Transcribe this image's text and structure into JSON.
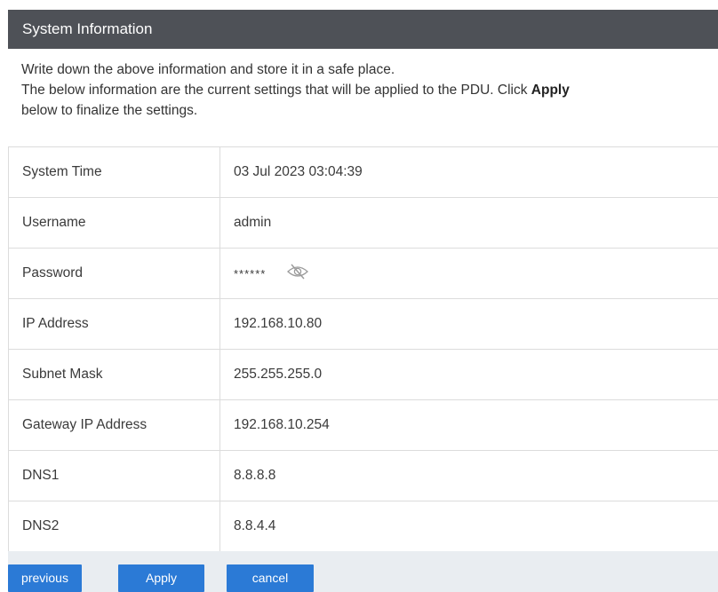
{
  "header": {
    "title": "System Information"
  },
  "intro": {
    "line1": "Write down the above information and store it in a safe place.",
    "line2_prefix": "The below information are the current settings that will be applied to the PDU. Click ",
    "line2_bold": "Apply",
    "line3": "below to finalize the settings."
  },
  "rows": [
    {
      "label": "System Time",
      "value": "03 Jul 2023 03:04:39"
    },
    {
      "label": "Username",
      "value": "admin"
    },
    {
      "label": "Password",
      "value": "******",
      "icon": "eye-slash-icon"
    },
    {
      "label": "IP Address",
      "value": "192.168.10.80"
    },
    {
      "label": "Subnet Mask",
      "value": "255.255.255.0"
    },
    {
      "label": "Gateway IP Address",
      "value": "192.168.10.254"
    },
    {
      "label": "DNS1",
      "value": "8.8.8.8"
    },
    {
      "label": "DNS2",
      "value": "8.8.4.4"
    }
  ],
  "buttons": {
    "previous": "previous",
    "apply": "Apply",
    "cancel": "cancel"
  },
  "colors": {
    "header_bg": "#4e5157",
    "button_bg": "#2b7ad6",
    "footer_bg": "#e9edf1"
  }
}
